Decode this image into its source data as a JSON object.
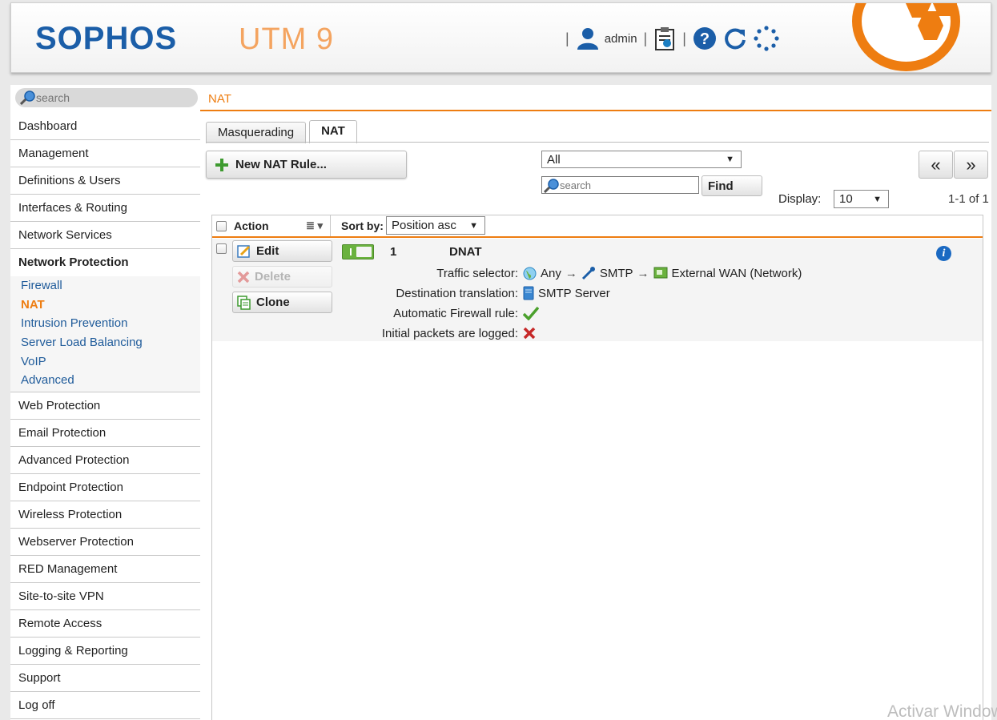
{
  "header": {
    "brand": "SOPHOS",
    "product": "UTM 9",
    "user": "admin"
  },
  "sidebar": {
    "search_placeholder": "search",
    "items": [
      {
        "label": "Dashboard"
      },
      {
        "label": "Management"
      },
      {
        "label": "Definitions & Users"
      },
      {
        "label": "Interfaces & Routing"
      },
      {
        "label": "Network Services"
      },
      {
        "label": "Network Protection"
      },
      {
        "label": "Web Protection"
      },
      {
        "label": "Email Protection"
      },
      {
        "label": "Advanced Protection"
      },
      {
        "label": "Endpoint Protection"
      },
      {
        "label": "Wireless Protection"
      },
      {
        "label": "Webserver Protection"
      },
      {
        "label": "RED Management"
      },
      {
        "label": "Site-to-site VPN"
      },
      {
        "label": "Remote Access"
      },
      {
        "label": "Logging & Reporting"
      },
      {
        "label": "Support"
      },
      {
        "label": "Log off"
      }
    ],
    "subitems": [
      {
        "label": "Firewall"
      },
      {
        "label": "NAT"
      },
      {
        "label": "Intrusion Prevention"
      },
      {
        "label": "Server Load Balancing"
      },
      {
        "label": "VoIP"
      },
      {
        "label": "Advanced"
      }
    ]
  },
  "main": {
    "breadcrumb": "NAT",
    "tabs": [
      {
        "label": "Masquerading"
      },
      {
        "label": "NAT"
      }
    ],
    "new_rule_label": "New NAT Rule...",
    "filter_value": "All",
    "search_placeholder": "search",
    "find_label": "Find",
    "display_label": "Display:",
    "display_value": "10",
    "prev_label": "«",
    "next_label": "»",
    "range": "1-1 of 1",
    "table": {
      "action_header": "Action",
      "sort_label": "Sort by:",
      "sort_value": "Position asc",
      "rows": [
        {
          "edit_label": "Edit",
          "delete_label": "Delete",
          "clone_label": "Clone",
          "number": "1",
          "type": "DNAT",
          "traffic_label": "Traffic selector:",
          "traffic_source": "Any",
          "traffic_service": "SMTP",
          "traffic_dest": "External WAN (Network)",
          "dest_label": "Destination translation:",
          "dest_value": "SMTP Server",
          "auto_fw_label": "Automatic Firewall rule:",
          "logged_label": "Initial packets are logged:",
          "info": "i"
        }
      ]
    }
  },
  "watermark": "Activar Windows",
  "colors": {
    "accent": "#ee7d11",
    "brand": "#1b5ea8",
    "link": "#1f5b9a",
    "enabled": "#6ab23e"
  }
}
